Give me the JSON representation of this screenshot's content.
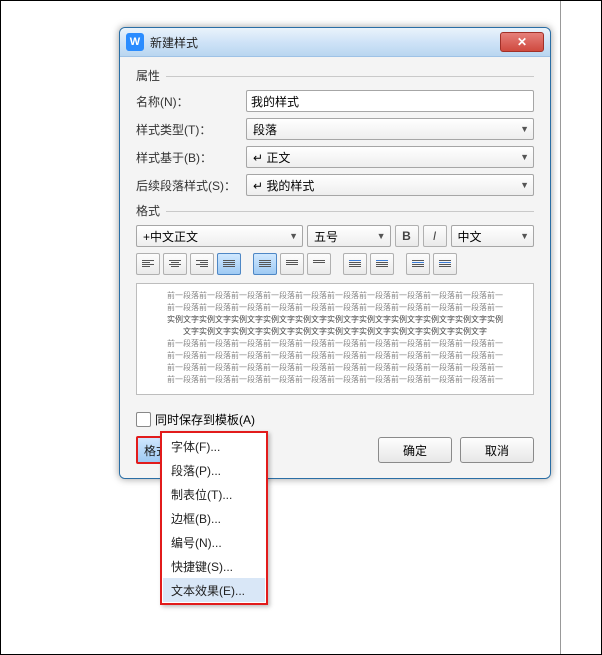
{
  "dialog": {
    "title": "新建样式",
    "close_glyph": "✕"
  },
  "groups": {
    "properties_label": "属性",
    "format_label": "格式"
  },
  "props": {
    "name_label": "名称(N)：",
    "name_value": "我的样式",
    "type_label": "样式类型(T)：",
    "type_value": "段落",
    "based_label": "样式基于(B)：",
    "based_value": "↵ 正文",
    "next_label": "后续段落样式(S)：",
    "next_value": "↵ 我的样式"
  },
  "format": {
    "font_value": "+中文正文",
    "size_value": "五号",
    "bold_label": "B",
    "italic_label": "I",
    "lang_value": "中文"
  },
  "preview": {
    "line_gray": "前一段落前一段落前一段落前一段落前一段落前一段落前一段落前一段落前一段落前一段落前一",
    "line_dark1": "实例文字实例文字实例文字实例文字实例文字实例文字实例文字实例文字实例文字实例文字实例",
    "line_dark2": "文字实例文字实例文字实例文字实例文字实例文字实例文字实例文字实例文字实例文字"
  },
  "save_template_label": "同时保存到模板(A)",
  "format_menu": {
    "button_label": "格式(O)",
    "items": [
      "字体(F)...",
      "段落(P)...",
      "制表位(T)...",
      "边框(B)...",
      "编号(N)...",
      "快捷键(S)...",
      "文本效果(E)..."
    ]
  },
  "buttons": {
    "ok": "确定",
    "cancel": "取消"
  }
}
